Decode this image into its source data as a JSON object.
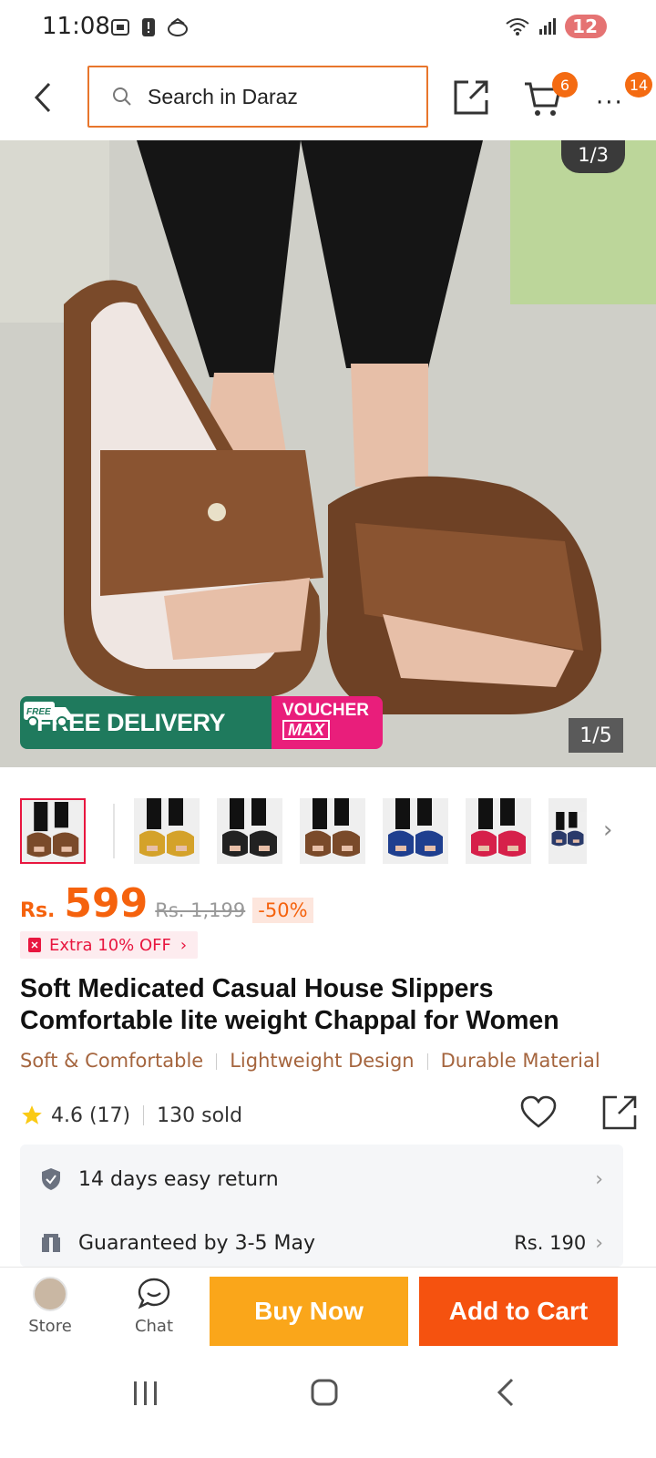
{
  "status_bar": {
    "time": "11:08",
    "battery": "12"
  },
  "header": {
    "search_placeholder": "Search in Daraz",
    "cart_count": "6",
    "more_count": "14"
  },
  "gallery": {
    "top_indicator": "1/3",
    "bottom_indicator": "1/5",
    "banner_free_delivery": "FREE DELIVERY",
    "banner_voucher_top": "VOUCHER",
    "banner_voucher_max": "MAX",
    "truck_label": "FREE"
  },
  "variants": {
    "colors": [
      "#7a4a2a",
      "#d4a22a",
      "#222222",
      "#7a4a2a",
      "#1f3f8f",
      "#d6204a",
      "#2a3a6a"
    ]
  },
  "price": {
    "currency": "Rs.",
    "value": "599",
    "original": "Rs. 1,199",
    "discount": "-50%",
    "extra_off": "Extra 10% OFF"
  },
  "product": {
    "title": "Soft Medicated Casual House Slippers Comfortable lite weight Chappal for Women",
    "highlights": [
      "Soft & Comfortable",
      "Lightweight Design",
      "Durable Material"
    ],
    "rating": "4.6 (17)",
    "sold": "130 sold"
  },
  "services": {
    "return_label": "14 days easy return",
    "delivery_label": "Guaranteed by 3-5 May",
    "delivery_price": "Rs. 190"
  },
  "actions": {
    "store_label": "Store",
    "chat_label": "Chat",
    "buy_now": "Buy Now",
    "add_to_cart": "Add to Cart"
  }
}
